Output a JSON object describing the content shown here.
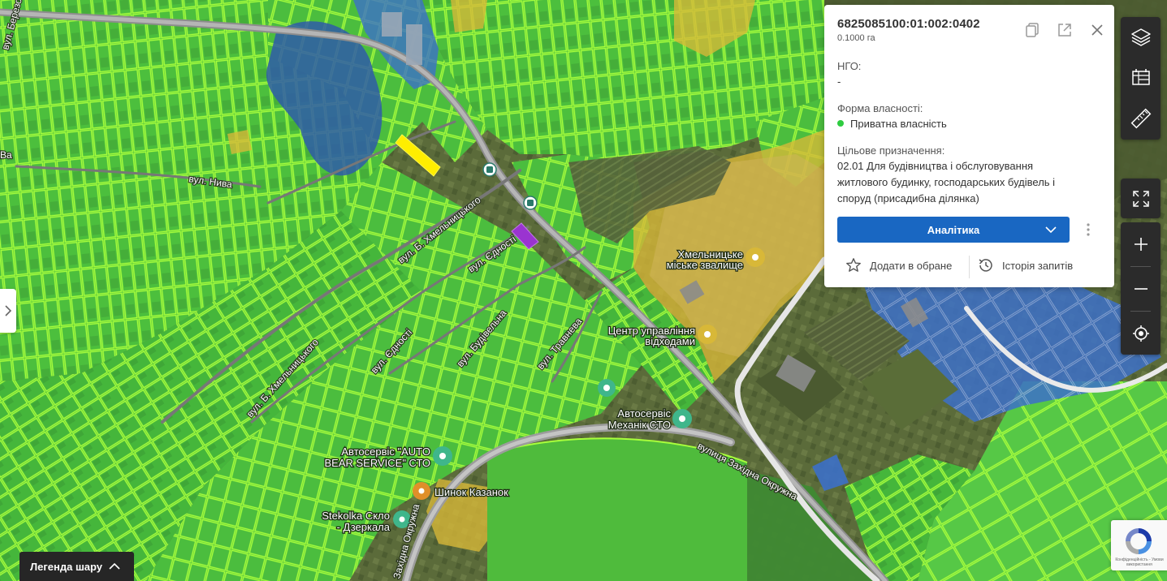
{
  "parcel": {
    "cadastral_number": "6825085100:01:002:0402",
    "area": "0.1000 га",
    "ngo_label": "НГО:",
    "ngo_value": "-",
    "ownership_label": "Форма власності:",
    "ownership_value": "Приватна власність",
    "ownership_color": "#2ecc40",
    "purpose_label": "Цільове призначення:",
    "purpose_line1": "02.01 Для будівництва і обслуговування",
    "purpose_line2": "житлового будинку, господарських будівель і",
    "purpose_line3": "споруд (присадибна ділянка)"
  },
  "panel_actions": {
    "analytics_label": "Аналітика",
    "favorite_label": "Додати в обране",
    "history_label": "Історія запитів",
    "icons": [
      "copy-icon",
      "open-external-icon",
      "close-icon",
      "chevron-down-icon",
      "more-vertical-icon",
      "star-icon",
      "history-icon"
    ]
  },
  "map_controls": {
    "icons": [
      "layers-icon",
      "cadastre-map-icon",
      "ruler-icon",
      "fullscreen-icon",
      "zoom-in-icon",
      "zoom-out-icon",
      "locate-icon"
    ]
  },
  "map_labels": {
    "poi_landfill_1": "Хмельницьке",
    "poi_landfill_2": "міське звалище",
    "poi_waste_1": "Центр управління",
    "poi_waste_2": "відходами",
    "poi_autoservice_mechanic_1": "Автосервіс",
    "poi_autoservice_mechanic_2": "Механік  СТО",
    "poi_autoservice_bear_1": "Автосервіс \"AUTO",
    "poi_autoservice_bear_2": "BEAR SERVICE\" СТО",
    "poi_tire": "Шинок Казанок",
    "poi_glass_1": "Stekolka Скло",
    "poi_glass_2": "- Дзеркала",
    "street_khmelnytskoho_top": "вул. Б. Хмельницького",
    "street_khmelnytskoho_bottom": "вул. Б. Хмельницького",
    "street_yednosti_top": "вул. Єдності",
    "street_yednosti_bottom": "вул. Єдності",
    "street_budivelna": "вул. Будівельна",
    "street_travneva": "вул. Травнева",
    "street_nyva": "вул. Нива",
    "street_zakhidna": "вулиця Західна Окружна",
    "street_okruzhna": "Західна Окружна",
    "street_berezova": "вул. Березова",
    "map_edge_label": "Ва"
  },
  "colors": {
    "parcel_private": "#48c23a",
    "parcel_outline": "#a8ff3c",
    "parcel_communal": "#d8b838",
    "parcel_state": "#3c70c8",
    "selected_parcel": "#ffee00",
    "highlight_parcel": "#9a34d0",
    "accent": "#1967c2"
  },
  "legend": {
    "label": "Легенда шару"
  },
  "recaptcha": {
    "text": "Конфіденційність - Умови використання"
  }
}
